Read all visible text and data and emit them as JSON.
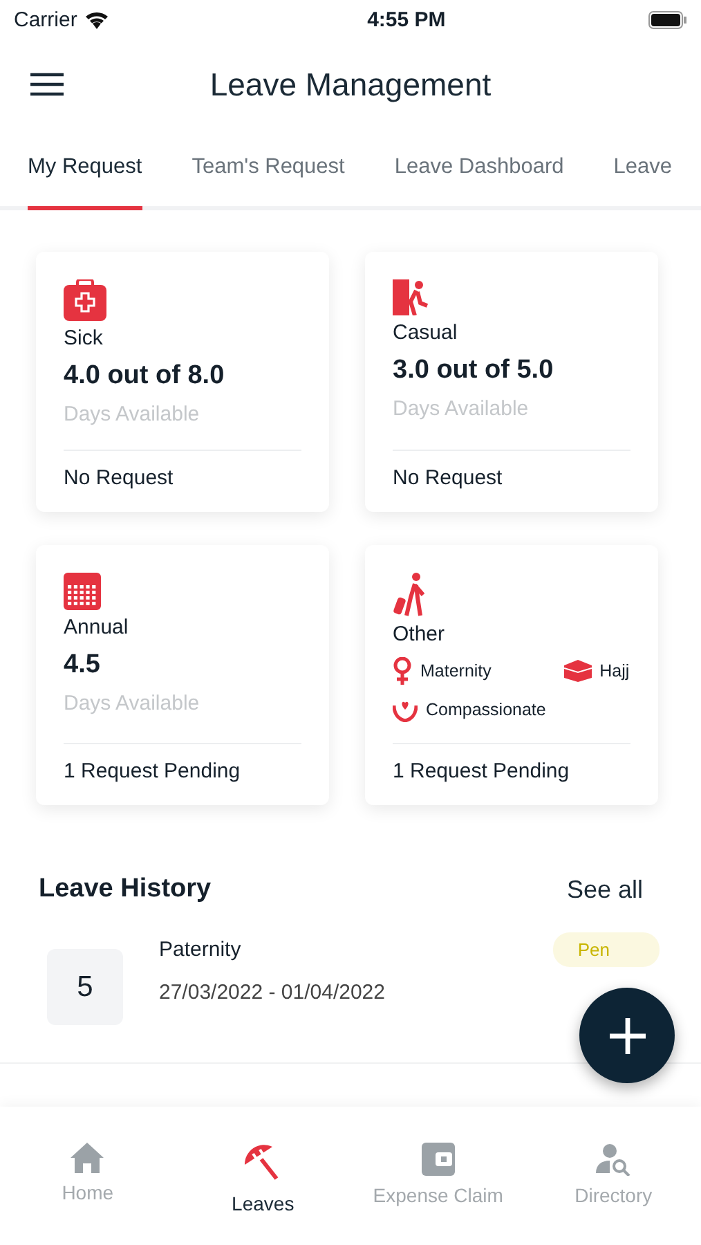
{
  "status_bar": {
    "carrier": "Carrier",
    "time": "4:55 PM"
  },
  "header": {
    "title": "Leave Management"
  },
  "tabs": [
    {
      "label": "My Request",
      "selected": true
    },
    {
      "label": "Team's Request",
      "selected": false
    },
    {
      "label": "Leave Dashboard",
      "selected": false
    },
    {
      "label": "Leave",
      "selected": false
    }
  ],
  "cards": [
    {
      "kind": "balance",
      "name": "Sick",
      "value": "4.0 out of 8.0",
      "caption": "Days Available",
      "status": "No Request"
    },
    {
      "kind": "balance",
      "name": "Casual",
      "value": "3.0 out of 5.0",
      "caption": "Days Available",
      "status": "No Request"
    },
    {
      "kind": "balance",
      "name": "Annual",
      "value": "4.5",
      "caption": "Days Available",
      "status": "1 Request Pending"
    },
    {
      "kind": "other",
      "name": "Other",
      "types": [
        "Maternity",
        "Hajj",
        "Compassionate"
      ],
      "status": "1 Request Pending"
    }
  ],
  "history": {
    "title": "Leave History",
    "see_all": "See all",
    "items": [
      {
        "days": "5",
        "type": "Paternity",
        "dates": "27/03/2022 - 01/04/2022",
        "status": "Pen"
      }
    ]
  },
  "nav": [
    {
      "label": "Home",
      "selected": false
    },
    {
      "label": "Leaves",
      "selected": true
    },
    {
      "label": "Expense Claim",
      "selected": false
    },
    {
      "label": "Directory",
      "selected": false
    }
  ]
}
